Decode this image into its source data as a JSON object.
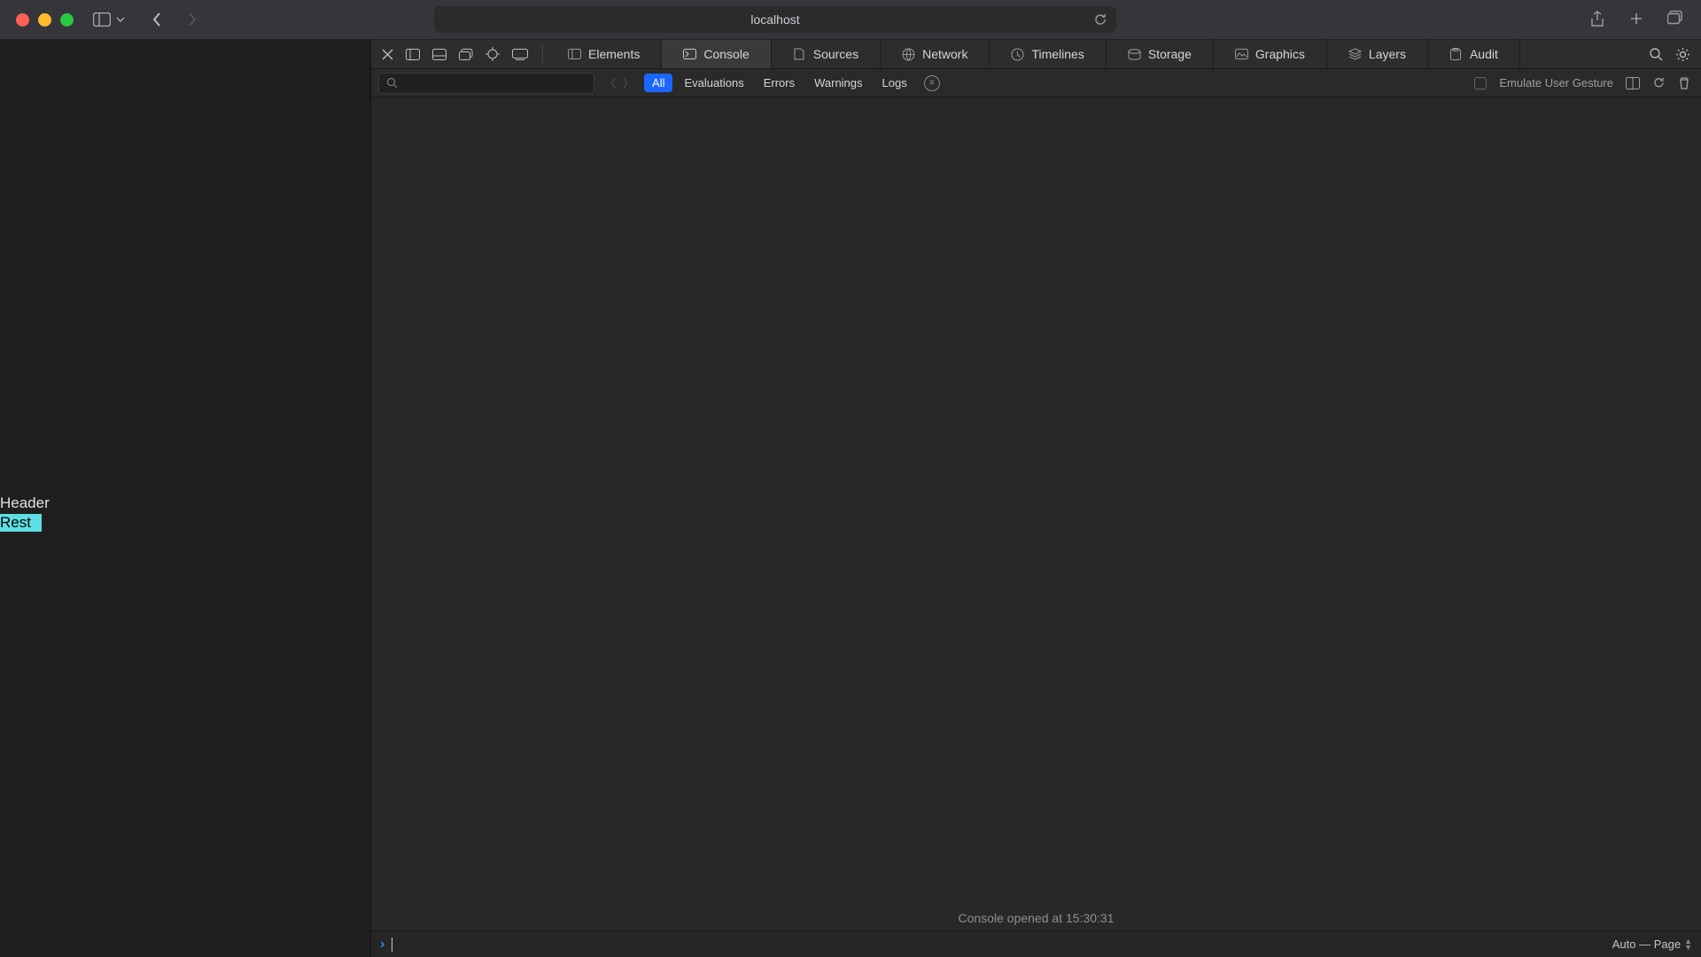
{
  "browser": {
    "address": "localhost",
    "nav_back_enabled": true,
    "nav_forward_enabled": false
  },
  "page": {
    "header_text": "Header",
    "rest_text": "Rest"
  },
  "devtools": {
    "tabs": [
      {
        "id": "elements",
        "label": "Elements"
      },
      {
        "id": "console",
        "label": "Console",
        "active": true
      },
      {
        "id": "sources",
        "label": "Sources"
      },
      {
        "id": "network",
        "label": "Network"
      },
      {
        "id": "timelines",
        "label": "Timelines"
      },
      {
        "id": "storage",
        "label": "Storage"
      },
      {
        "id": "graphics",
        "label": "Graphics"
      },
      {
        "id": "layers",
        "label": "Layers"
      },
      {
        "id": "audit",
        "label": "Audit"
      }
    ],
    "filter": {
      "pills": [
        {
          "id": "all",
          "label": "All",
          "active": true
        },
        {
          "id": "evaluations",
          "label": "Evaluations"
        },
        {
          "id": "errors",
          "label": "Errors"
        },
        {
          "id": "warnings",
          "label": "Warnings"
        },
        {
          "id": "logs",
          "label": "Logs"
        }
      ],
      "emulate_label": "Emulate User Gesture"
    },
    "console_opened_label": "Console opened at 15:30:31",
    "context_label": "Auto — Page"
  }
}
